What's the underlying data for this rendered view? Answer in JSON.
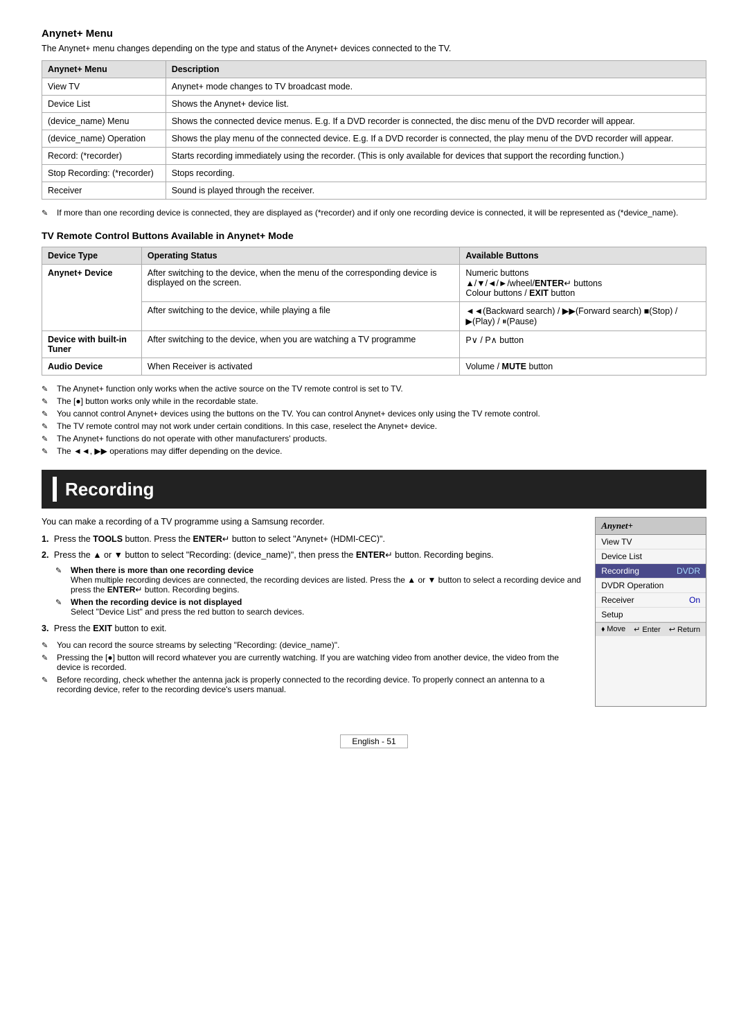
{
  "anynet_menu": {
    "title": "Anynet+ Menu",
    "intro": "The Anynet+ menu changes depending on the type and status of the Anynet+ devices connected to the TV.",
    "table": {
      "headers": [
        "Anynet+ Menu",
        "Description"
      ],
      "rows": [
        [
          "View TV",
          "Anynet+ mode changes to TV broadcast mode."
        ],
        [
          "Device List",
          "Shows the Anynet+ device list."
        ],
        [
          "(device_name) Menu",
          "Shows the connected device menus. E.g. If a DVD recorder is connected, the disc menu of the DVD recorder will appear."
        ],
        [
          "(device_name) Operation",
          "Shows the play menu of the connected device. E.g. If a DVD recorder is connected, the play menu of the DVD recorder will appear."
        ],
        [
          "Record: (*recorder)",
          "Starts recording immediately using the recorder. (This is only available for devices that support the recording function.)"
        ],
        [
          "Stop Recording: (*recorder)",
          "Stops recording."
        ],
        [
          "Receiver",
          "Sound is played through the receiver."
        ]
      ]
    },
    "notes": [
      "If more than one recording device is connected, they are displayed as (*recorder) and if only one recording device is connected, it will be represented as (*device_name)."
    ]
  },
  "tv_remote": {
    "title": "TV Remote Control Buttons Available in Anynet+ Mode",
    "table": {
      "headers": [
        "Device Type",
        "Operating Status",
        "Available Buttons"
      ],
      "rows": [
        {
          "device": "Anynet+ Device",
          "operating_rows": [
            {
              "status": "After switching to the device, when the menu of the corresponding device is displayed on the screen.",
              "buttons": "Numeric buttons\n▲/▼/◄/►/wheel/ENTER↵ buttons\nColour buttons / EXIT button"
            },
            {
              "status": "After switching to the device, while playing a file",
              "buttons": "◄◄(Backward search) / ►►(Forward search) ■(Stop) / ►(Play) / ⏸(Pause)"
            }
          ]
        },
        {
          "device": "Device with built-in Tuner",
          "operating_rows": [
            {
              "status": "After switching to the device, when you are watching a TV programme",
              "buttons": "P∨ / P∧ button"
            }
          ]
        },
        {
          "device": "Audio Device",
          "operating_rows": [
            {
              "status": "When Receiver is activated",
              "buttons": "Volume / MUTE button"
            }
          ]
        }
      ]
    },
    "notes": [
      "The Anynet+ function only works when the active source on the TV remote control is set to TV.",
      "The ● button works only while in the recordable state.",
      "You cannot control Anynet+ devices using the buttons on the TV. You can control Anynet+ devices only using the TV remote control.",
      "The TV remote control may not work under certain conditions. In this case, reselect the Anynet+ device.",
      "The Anynet+ functions do not operate with other manufacturers' products.",
      "The ◄◄, ►► operations may differ depending on the device."
    ]
  },
  "recording": {
    "title": "Recording",
    "intro": "You can make a recording of a TV programme using a Samsung recorder.",
    "steps": [
      {
        "num": "1.",
        "text": "Press the TOOLS button. Press the ENTER↵ button to select \"Anynet+ (HDMI-CEC)\"."
      },
      {
        "num": "2.",
        "text": "Press the ▲ or ▼ button to select \"Recording: (device_name)\", then press the ENTER↵ button. Recording begins."
      }
    ],
    "sub_notes": [
      {
        "bold": "When there is more than one recording device",
        "text": "When multiple recording devices are connected, the recording devices are listed. Press the ▲ or ▼ button to select a recording device and press the ENTER↵ button. Recording begins."
      },
      {
        "bold": "When the recording device is not displayed",
        "text": "Select \"Device List\" and press the red button to search devices."
      }
    ],
    "step3": "Press the EXIT button to exit.",
    "bottom_notes": [
      "You can record the source streams by selecting \"Recording: (device_name)\".",
      "Pressing the ● button will record whatever you are currently watching. If you are watching video from another device, the video from the device is recorded.",
      "Before recording, check whether the antenna jack is properly connected to the recording device. To properly connect an antenna to a recording device, refer to the recording device's users manual."
    ]
  },
  "tv_menu_mockup": {
    "header": "Anynet+",
    "items": [
      {
        "label": "View TV",
        "value": "",
        "highlighted": false
      },
      {
        "label": "Device List",
        "value": "",
        "highlighted": false
      },
      {
        "label": "Recording",
        "value": "DVDR",
        "highlighted": true
      },
      {
        "label": "DVDR Operation",
        "value": "",
        "highlighted": false
      },
      {
        "label": "Receiver",
        "value": "On",
        "highlighted": false
      },
      {
        "label": "Setup",
        "value": "",
        "highlighted": false
      }
    ],
    "footer": [
      "⬧ Move",
      "↵ Enter",
      "↩ Return"
    ]
  },
  "page_footer": {
    "text": "English - 51"
  }
}
